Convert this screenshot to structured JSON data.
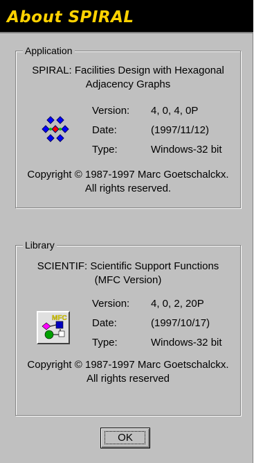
{
  "window": {
    "title": "About SPIRAL"
  },
  "application": {
    "group_label": "Application",
    "description_line1": "SPIRAL: Facilities Design with Hexagonal",
    "description_line2": "Adjacency Graphs",
    "version_label": "Version:",
    "version_value": "4, 0, 4, 0P",
    "date_label": "Date:",
    "date_value": "(1997/11/12)",
    "type_label": "Type:",
    "type_value": "Windows-32 bit",
    "copyright_line1": "Copyright © 1987-1997 Marc Goetschalckx.",
    "copyright_line2": "All rights reserved.",
    "icon": "hexagon-graph-icon"
  },
  "library": {
    "group_label": "Library",
    "description_line1": "SCIENTIF: Scientific Support Functions",
    "description_line2": "(MFC Version)",
    "version_label": "Version:",
    "version_value": "4, 0, 2, 20P",
    "date_label": "Date:",
    "date_value": "(1997/10/17)",
    "type_label": "Type:",
    "type_value": "Windows-32 bit",
    "copyright_line1": "Copyright © 1987-1997 Marc Goetschalckx.",
    "copyright_line2": "All rights reserved",
    "icon_text": "MFC",
    "icon": "mfc-library-icon"
  },
  "buttons": {
    "ok_label": "OK"
  },
  "colors": {
    "title_bg": "#000000",
    "title_text": "#ffd200",
    "dialog_bg": "#c0c0c0",
    "node_blue": "#0000ff",
    "node_red": "#ff0000",
    "node_green": "#00c000"
  }
}
